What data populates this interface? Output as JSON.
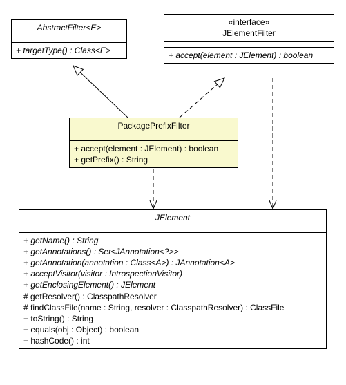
{
  "classes": {
    "abstractFilter": {
      "name": "AbstractFilter<E>",
      "ops": [
        "+ targetType() : Class<E>"
      ]
    },
    "jelementFilter": {
      "stereotype": "«interface»",
      "name": "JElementFilter",
      "ops": [
        "+ accept(element : JElement) : boolean"
      ]
    },
    "packagePrefixFilter": {
      "name": "PackagePrefixFilter",
      "ops": [
        "+ accept(element : JElement) : boolean",
        "+ getPrefix() : String"
      ]
    },
    "jelement": {
      "name": "JElement",
      "ops": [
        "+ getName() : String",
        "+ getAnnotations() : Set<JAnnotation<?>>",
        "+ getAnnotation(annotation : Class<A>) : JAnnotation<A>",
        "+ acceptVisitor(visitor : IntrospectionVisitor)",
        "+ getEnclosingElement() : JElement",
        "# getResolver() : ClasspathResolver",
        "# findClassFile(name : String, resolver : ClasspathResolver) : ClassFile",
        "+ toString() : String",
        "+ equals(obj : Object) : boolean",
        "+ hashCode() : int"
      ]
    }
  },
  "chart_data": {
    "type": "table",
    "title": "UML Class Diagram",
    "nodes": [
      {
        "id": "AbstractFilter<E>",
        "kind": "abstract-class",
        "members": [
          "+ targetType() : Class<E>"
        ]
      },
      {
        "id": "JElementFilter",
        "kind": "interface",
        "members": [
          "+ accept(element : JElement) : boolean"
        ]
      },
      {
        "id": "PackagePrefixFilter",
        "kind": "class",
        "members": [
          "+ accept(element : JElement) : boolean",
          "+ getPrefix() : String"
        ]
      },
      {
        "id": "JElement",
        "kind": "abstract-class",
        "members": [
          "+ getName() : String",
          "+ getAnnotations() : Set<JAnnotation<?>>",
          "+ getAnnotation(annotation : Class<A>) : JAnnotation<A>",
          "+ acceptVisitor(visitor : IntrospectionVisitor)",
          "+ getEnclosingElement() : JElement",
          "# getResolver() : ClasspathResolver",
          "# findClassFile(name : String, resolver : ClasspathResolver) : ClassFile",
          "+ toString() : String",
          "+ equals(obj : Object) : boolean",
          "+ hashCode() : int"
        ]
      }
    ],
    "edges": [
      {
        "from": "PackagePrefixFilter",
        "to": "AbstractFilter<E>",
        "relation": "generalization"
      },
      {
        "from": "PackagePrefixFilter",
        "to": "JElementFilter",
        "relation": "realization"
      },
      {
        "from": "PackagePrefixFilter",
        "to": "JElement",
        "relation": "dependency"
      },
      {
        "from": "JElementFilter",
        "to": "JElement",
        "relation": "dependency"
      }
    ]
  }
}
